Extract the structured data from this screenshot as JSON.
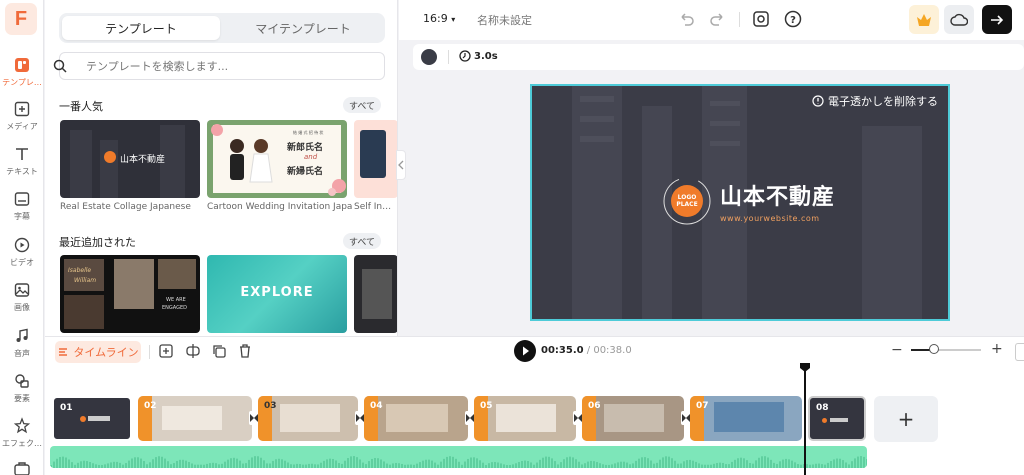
{
  "rail": {
    "items": [
      {
        "label": "テンプレ…",
        "icon": "template-icon",
        "active": true
      },
      {
        "label": "メディア",
        "icon": "media-icon"
      },
      {
        "label": "テキスト",
        "icon": "text-icon"
      },
      {
        "label": "字幕",
        "icon": "subtitle-icon"
      },
      {
        "label": "ビデオ",
        "icon": "video-icon"
      },
      {
        "label": "画像",
        "icon": "image-icon"
      },
      {
        "label": "音声",
        "icon": "music-icon"
      },
      {
        "label": "要素",
        "icon": "shapes-icon"
      },
      {
        "label": "エフェク…",
        "icon": "effects-icon"
      }
    ]
  },
  "panel": {
    "tabs": [
      "テンプレート",
      "マイテンプレート"
    ],
    "search_placeholder": "テンプレートを検索します...",
    "popular_title": "一番人気",
    "recent_title": "最近追加された",
    "see_all": "すべて",
    "popular": [
      {
        "caption": "Real Estate Collage Japanese",
        "text": "山本不動産"
      },
      {
        "caption": "Cartoon Wedding Invitation Japa…",
        "line1": "新郎氏名",
        "amp": "and",
        "line2": "新婦氏名",
        "top": "結 婚 式 招 待 状"
      },
      {
        "caption": "Self In…"
      }
    ],
    "recent": [
      {
        "text1": "Isabelle",
        "text2": "William",
        "text3": "WE ARE",
        "text4": "ENGAGED"
      },
      {
        "text": "EXPLORE"
      },
      {}
    ]
  },
  "topbar": {
    "ratio": "16:9",
    "project_name": "名称未設定"
  },
  "tools": {
    "duration": "3.0s"
  },
  "canvas": {
    "watermark": "電子透かしを削除する",
    "logo_line1": "LOGO",
    "logo_line2": "PLACE",
    "title": "山本不動産",
    "url": "www.yourwebsite.com"
  },
  "timeline": {
    "label": "タイムライン",
    "current": "00:35.0",
    "total": "/ 00:38.0",
    "zoom": 0.33,
    "clips": [
      "01",
      "02",
      "03",
      "04",
      "05",
      "06",
      "07",
      "08"
    ],
    "add": "+"
  },
  "colors": {
    "accent": "#f06a3a",
    "canvas_bg": "#3b3c47",
    "selection": "#4ecbd8",
    "audio": "#7de6b9"
  }
}
